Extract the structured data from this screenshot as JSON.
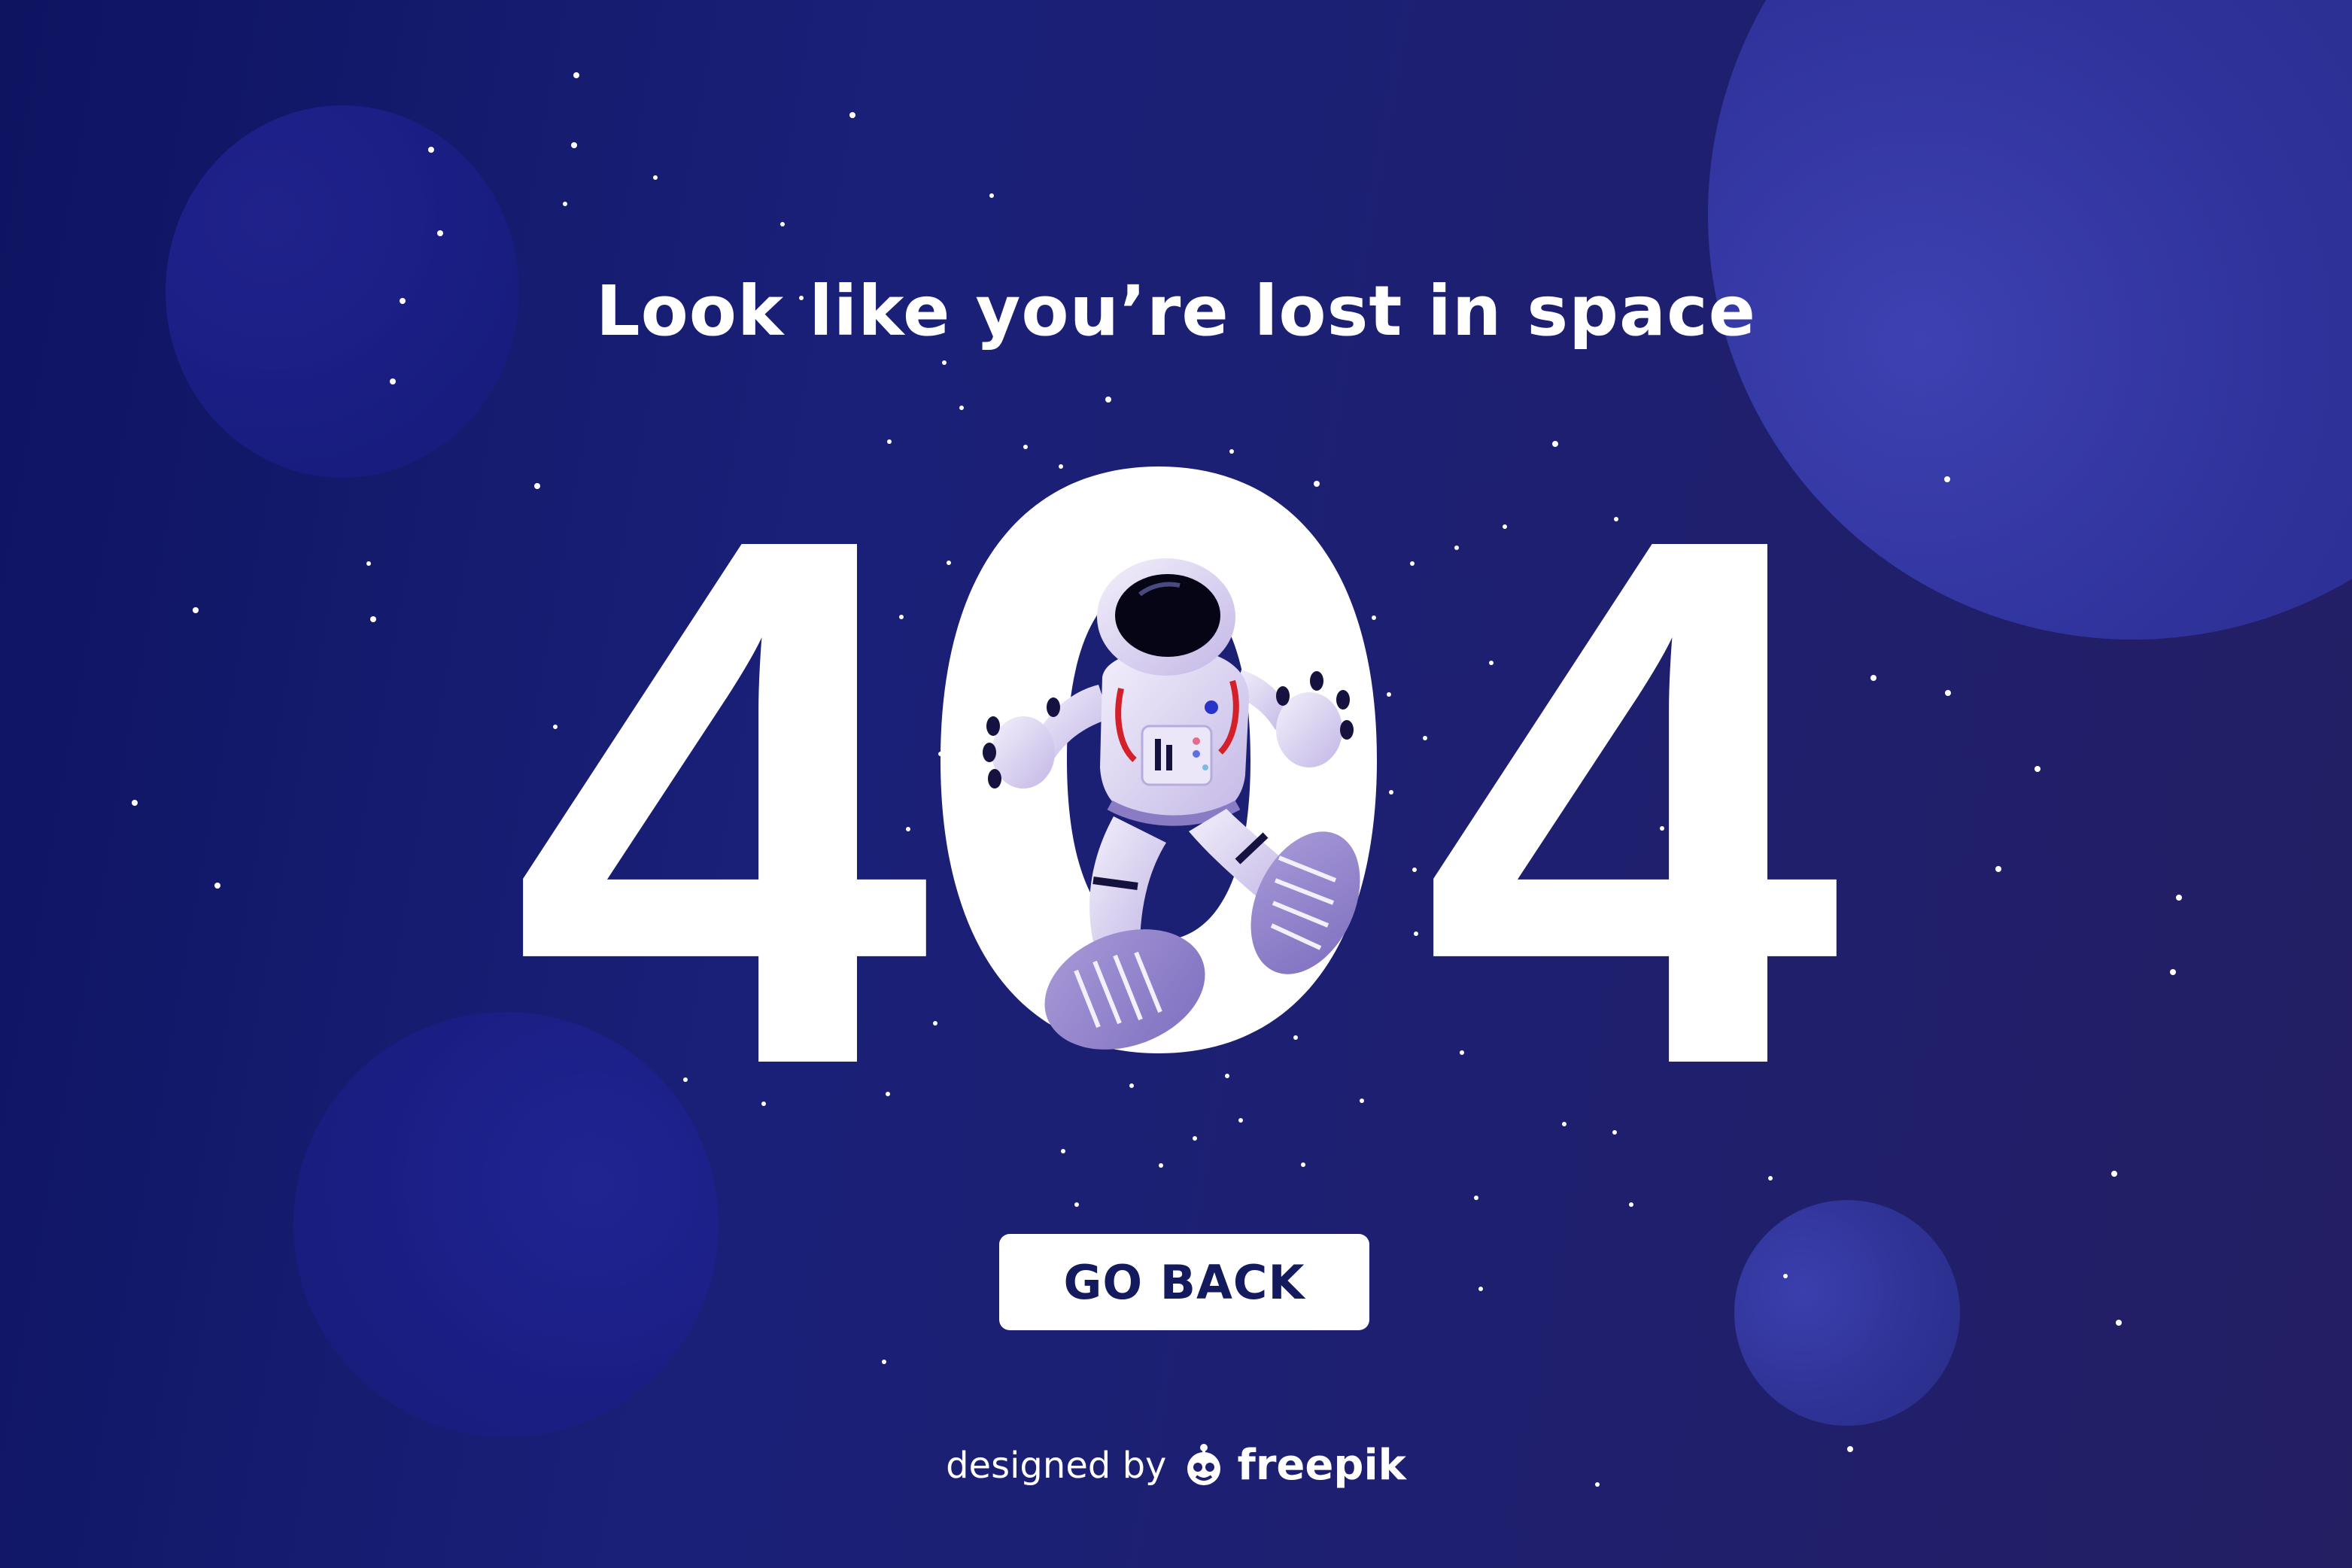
{
  "headline": "Look like you’re lost in space",
  "error_code": {
    "first": "4",
    "middle": "0",
    "last": "4"
  },
  "go_back_label": "GO BACK",
  "credit": {
    "prefix": "designed by",
    "brand": "freepik"
  },
  "colors": {
    "background_left": "#0e1460",
    "background_right": "#241f63",
    "text": "#ffffff",
    "button_text": "#141a5e",
    "button_bg": "#ffffff"
  },
  "icons": [
    "astronaut-illustration",
    "freepik-logo-icon"
  ]
}
